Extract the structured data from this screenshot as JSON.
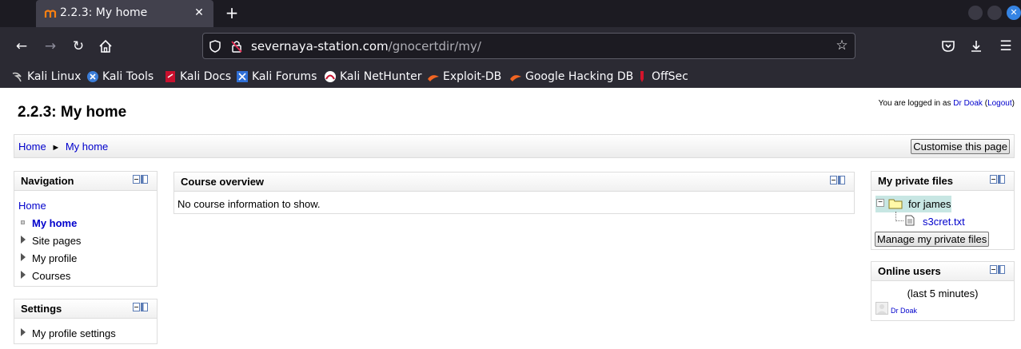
{
  "browser": {
    "tab_title": "2.2.3: My home",
    "url_domain": "severnaya-station.com",
    "url_path": "/gnocertdir/my/",
    "bookmarks": [
      {
        "label": "Kali Linux",
        "icon": "kali-dragon-icon"
      },
      {
        "label": "Kali Tools",
        "icon": "kali-tools-icon"
      },
      {
        "label": "Kali Docs",
        "icon": "kali-docs-icon"
      },
      {
        "label": "Kali Forums",
        "icon": "kali-forums-icon"
      },
      {
        "label": "Kali NetHunter",
        "icon": "nethunter-icon"
      },
      {
        "label": "Exploit-DB",
        "icon": "exploit-db-icon"
      },
      {
        "label": "Google Hacking DB",
        "icon": "ghdb-icon"
      },
      {
        "label": "OffSec",
        "icon": "offsec-icon"
      }
    ],
    "accent_color": "#3584e4"
  },
  "page": {
    "title": "2.2.3: My home",
    "login": {
      "prefix": "You are logged in as",
      "user": "Dr Doak",
      "open_paren": "(",
      "logout": "Logout",
      "close_paren": ")"
    },
    "breadcrumb": {
      "home": "Home",
      "separator": "►",
      "current": "My home"
    },
    "customise_button": "Customise this page",
    "navigation": {
      "title": "Navigation",
      "home": "Home",
      "items": [
        "My home",
        "Site pages",
        "My profile",
        "Courses"
      ]
    },
    "settings": {
      "title": "Settings",
      "items": [
        "My profile settings"
      ]
    },
    "course_overview": {
      "title": "Course overview",
      "empty_text": "No course information to show."
    },
    "private_files": {
      "title": "My private files",
      "folder": "for james",
      "file": "s3cret.txt",
      "manage_button": "Manage my private files"
    },
    "online_users": {
      "title": "Online users",
      "period": "(last 5 minutes)",
      "users": [
        "Dr Doak"
      ]
    }
  }
}
